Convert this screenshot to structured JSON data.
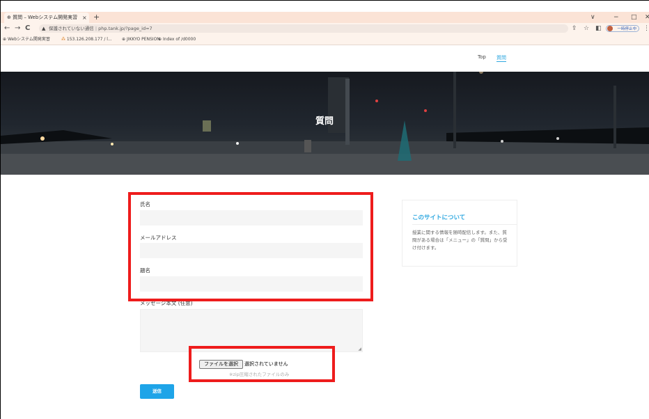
{
  "browser": {
    "tab_title": "質問 – Webシステム開発実習",
    "tab_close": "×",
    "new_tab": "+",
    "window_controls": {
      "collapse": "∨",
      "minimize": "−",
      "maximize": "□",
      "close": "✕"
    },
    "nav": {
      "back": "←",
      "forward": "→",
      "reload": "C"
    },
    "security_warning": "保護されていない通信",
    "url": "php.tank.jp/?page_id=7",
    "profile_label": "一時停止中",
    "bookmarks": [
      {
        "label": "Webシステム開発実習",
        "icon": "globe-icon"
      },
      {
        "label": "153.126.208.177 / l...",
        "icon": "phpmyadmin-icon"
      },
      {
        "label": "JIKKYO PENSION",
        "icon": "globe-icon"
      },
      {
        "label": "Index of /d0000",
        "icon": "globe-icon"
      }
    ]
  },
  "site_nav": {
    "top": "Top",
    "question": "質問"
  },
  "hero": {
    "title": "質問"
  },
  "form": {
    "name_label": "氏名",
    "email_label": "メールアドレス",
    "subject_label": "題名",
    "message_label": "メッセージ本文 (任意)",
    "file_button": "ファイルを選択",
    "file_status": "選択されていません",
    "file_note": "※zip圧縮されたファイルのみ",
    "submit_label": "送信"
  },
  "sidebar": {
    "title": "このサイトについて",
    "text": "授業に関する情報を随時配信します。また、質問がある場合は「メニュー」の「質問」から受け付けます。"
  },
  "colors": {
    "accent": "#2fa8e0",
    "submit": "#1ea4e8",
    "highlight": "#ee1c1c",
    "tabstrip": "#fbe3d6"
  }
}
